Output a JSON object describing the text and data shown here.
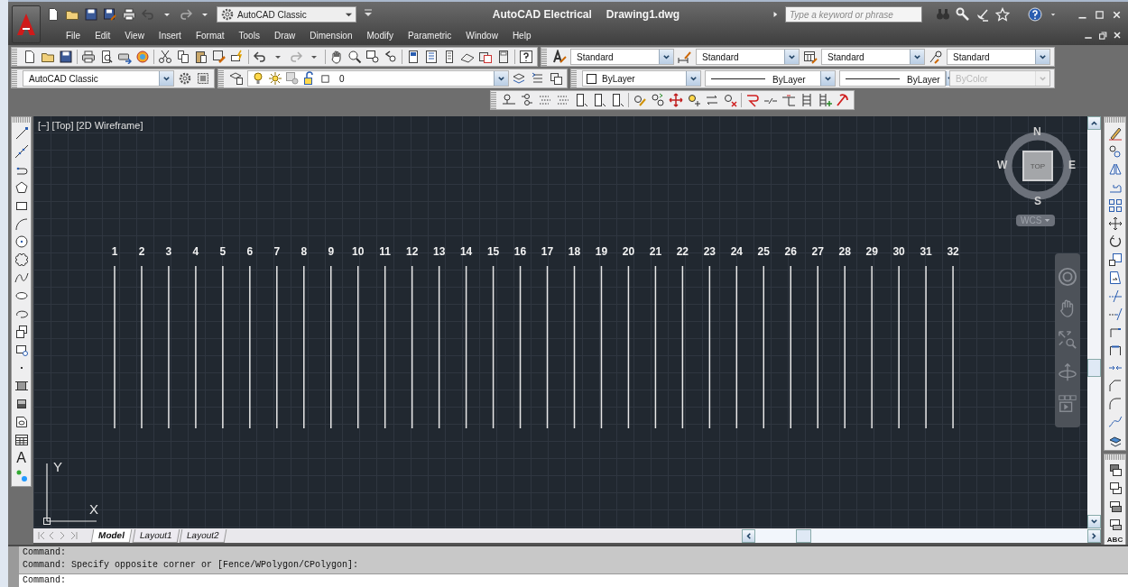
{
  "title_bar": {
    "workspace": "AutoCAD Classic",
    "app_title": "AutoCAD Electrical",
    "file_name": "Drawing1.dwg",
    "search": {
      "placeholder": "Type a keyword or phrase"
    }
  },
  "menu": [
    "File",
    "Edit",
    "View",
    "Insert",
    "Format",
    "Tools",
    "Draw",
    "Dimension",
    "Modify",
    "Parametric",
    "Window",
    "Help"
  ],
  "styles_toolbar": [
    "Standard",
    "Standard",
    "Standard",
    "Standard"
  ],
  "workspace_toolbar": {
    "workspace": "AutoCAD Classic"
  },
  "layers_toolbar": {
    "layer": "0"
  },
  "properties_toolbar": [
    {
      "text": "ByLayer",
      "kind": "color",
      "disabled": false
    },
    {
      "text": "ByLayer",
      "kind": "linetype",
      "disabled": false
    },
    {
      "text": "ByLayer",
      "kind": "lineweight",
      "disabled": false
    },
    {
      "text": "ByColor",
      "kind": "plotstyle",
      "disabled": true
    }
  ],
  "draw_toolbar": {
    "text_tool": "A"
  },
  "modify_toolbar": {
    "text_tool": "ABC"
  },
  "viewport": {
    "label": "[−] [Top] [2D Wireframe]",
    "wires": [
      "1",
      "2",
      "3",
      "4",
      "5",
      "6",
      "7",
      "8",
      "9",
      "10",
      "11",
      "12",
      "13",
      "14",
      "15",
      "16",
      "17",
      "18",
      "19",
      "20",
      "21",
      "22",
      "23",
      "24",
      "25",
      "26",
      "27",
      "28",
      "29",
      "30",
      "31",
      "32"
    ],
    "view_cube": {
      "north": "N",
      "south": "S",
      "east": "E",
      "west": "W",
      "face": "TOP",
      "ucs": "WCS"
    },
    "ucs_icon": {
      "x": "X",
      "y": "Y"
    }
  },
  "layout_tabs": [
    {
      "label": "Model",
      "selected": true
    },
    {
      "label": "Layout1",
      "selected": false
    },
    {
      "label": "Layout2",
      "selected": false
    }
  ],
  "command_history": [
    "Command:",
    "Command: Specify opposite corner or [Fence/WPolygon/CPolygon]:"
  ],
  "command_line": {
    "prompt": "Command:"
  }
}
